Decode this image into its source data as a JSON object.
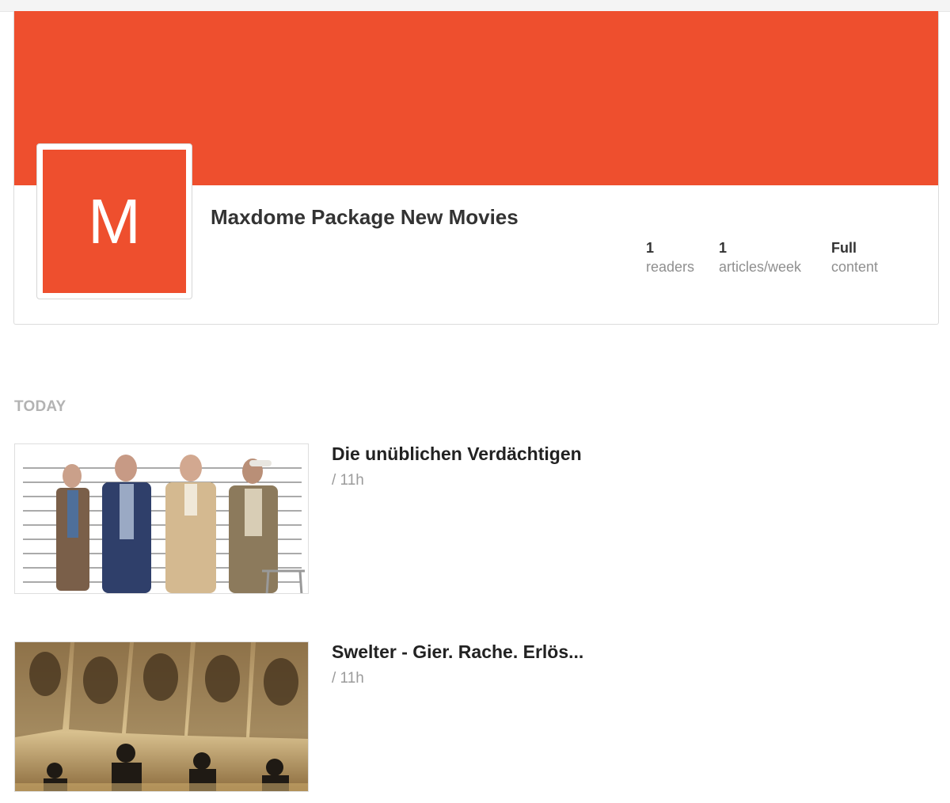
{
  "feed": {
    "logo_letter": "M",
    "title": "Maxdome Package New Movies",
    "brand_color": "#ee4f2e",
    "stats": [
      {
        "value": "1",
        "label": "readers"
      },
      {
        "value": "1",
        "label": "articles/week"
      },
      {
        "value": "Full",
        "label": "content"
      }
    ]
  },
  "section": {
    "label": "TODAY"
  },
  "articles": [
    {
      "title": "Die unüblichen Verdächtigen",
      "meta": "/ 11h",
      "thumbnail": "lineup-poster-image"
    },
    {
      "title": "Swelter - Gier. Rache. Erlös...",
      "meta": "/ 11h",
      "thumbnail": "western-poster-image"
    }
  ]
}
